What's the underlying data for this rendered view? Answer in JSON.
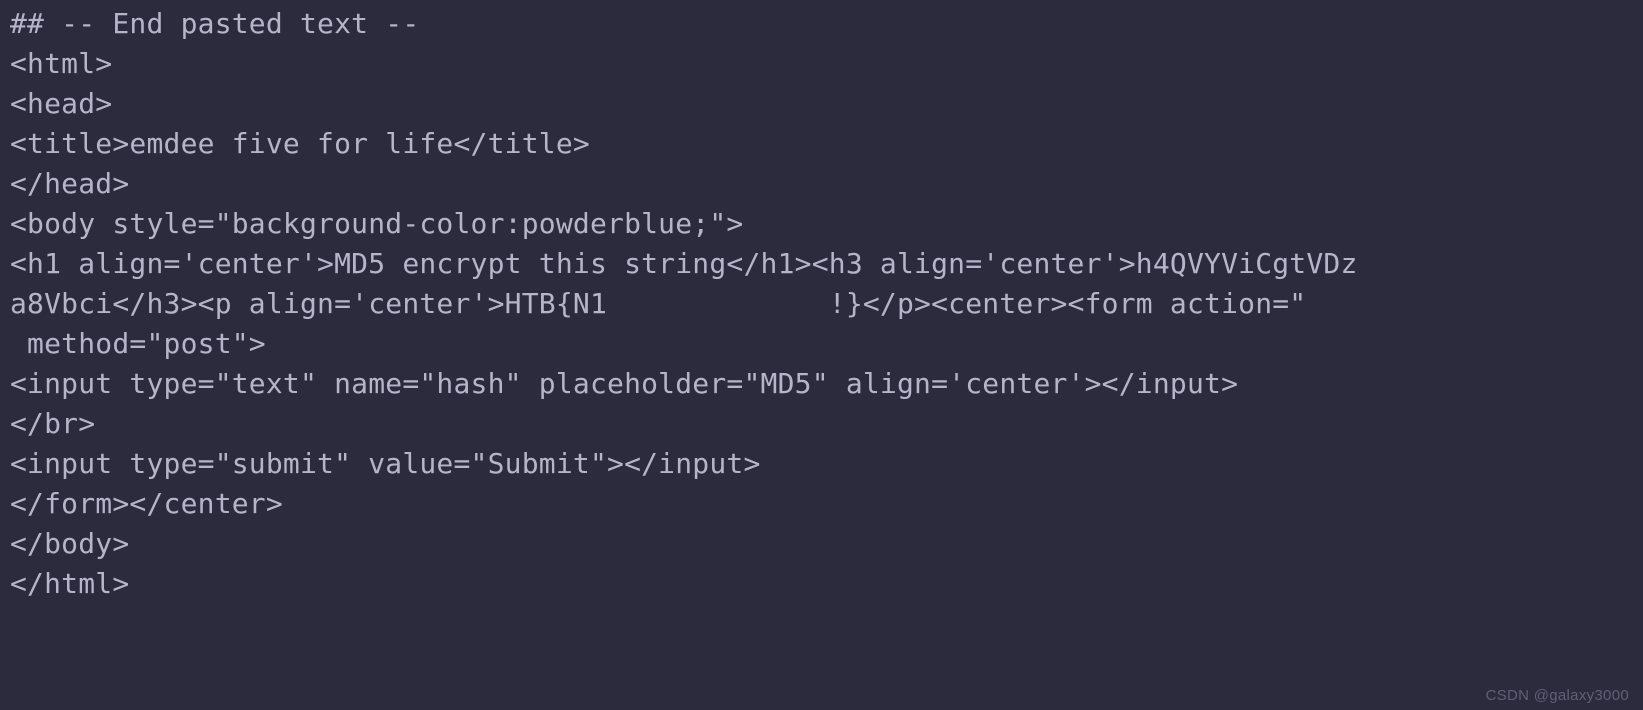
{
  "code": {
    "lines": [
      "## -- End pasted text --",
      "<html>",
      "<head>",
      "<title>emdee five for life</title>",
      "</head>",
      "<body style=\"background-color:powderblue;\">",
      "<h1 align='center'>MD5 encrypt this string</h1><h3 align='center'>h4QVYViCgtVDz",
      "a8Vbci</h3><p align='center'>HTB{N1             !}</p><center><form action=\"",
      " method=\"post\">",
      "<input type=\"text\" name=\"hash\" placeholder=\"MD5\" align='center'></input>",
      "</br>",
      "<input type=\"submit\" value=\"Submit\"></input>",
      "</form></center>",
      "</body>",
      "</html>"
    ]
  },
  "watermark": "CSDN @galaxy3000"
}
